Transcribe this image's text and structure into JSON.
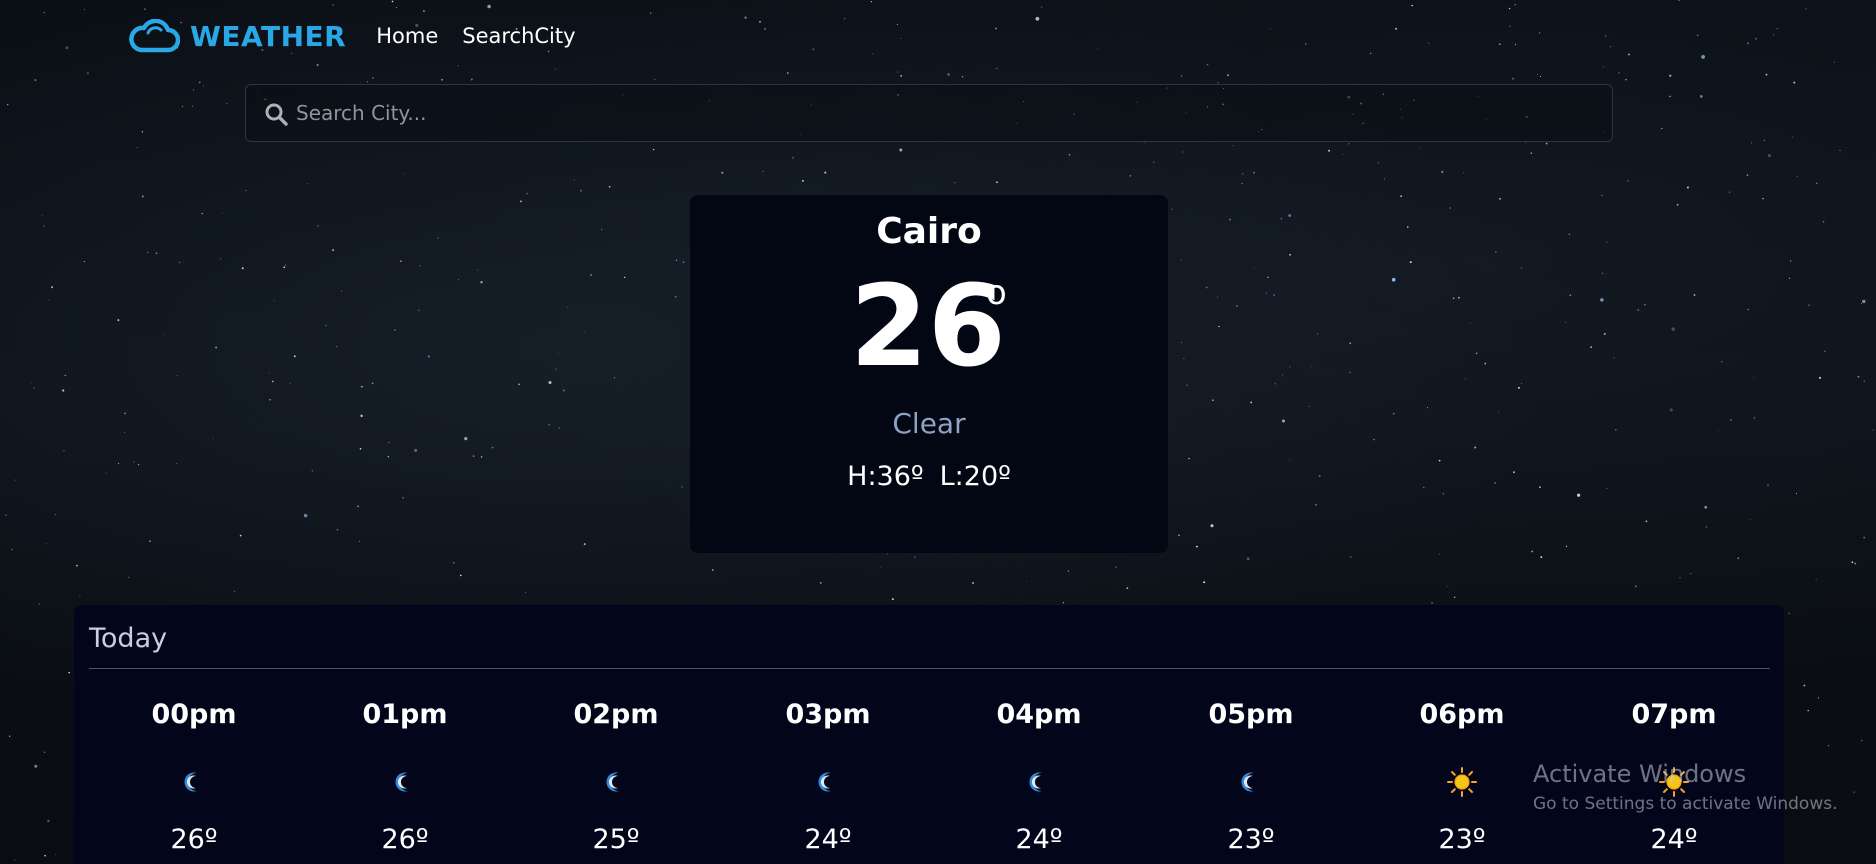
{
  "navbar": {
    "brand": "WEATHER",
    "brand_icon": "cloud-icon",
    "links": [
      {
        "label": "Home"
      },
      {
        "label": "SearchCity"
      }
    ],
    "brand_color": "#2aa7e6"
  },
  "search": {
    "placeholder": "Search City...",
    "value": "",
    "icon": "search-icon"
  },
  "current": {
    "city": "Cairo",
    "temperature": "26",
    "degree_symbol": "o",
    "condition": "Clear",
    "high": "H:36º",
    "low": "L:20º"
  },
  "today": {
    "title": "Today",
    "hours": [
      {
        "time": "00pm",
        "icon": "moon-icon",
        "temp": "26º"
      },
      {
        "time": "01pm",
        "icon": "moon-icon",
        "temp": "26º"
      },
      {
        "time": "02pm",
        "icon": "moon-icon",
        "temp": "25º"
      },
      {
        "time": "03pm",
        "icon": "moon-icon",
        "temp": "24º"
      },
      {
        "time": "04pm",
        "icon": "moon-icon",
        "temp": "24º"
      },
      {
        "time": "05pm",
        "icon": "moon-icon",
        "temp": "23º"
      },
      {
        "time": "06pm",
        "icon": "sun-icon",
        "temp": "23º"
      },
      {
        "time": "07pm",
        "icon": "sun-icon",
        "temp": "24º"
      }
    ]
  },
  "watermark": {
    "title": "Activate Windows",
    "subtitle": "Go to Settings to activate Windows."
  },
  "colors": {
    "background": "#0a0f15",
    "card": "#020713",
    "panel": "#03061a",
    "condition_text": "#8ea2c2",
    "moon": "#2f8be0",
    "sun": "#f5c518"
  }
}
